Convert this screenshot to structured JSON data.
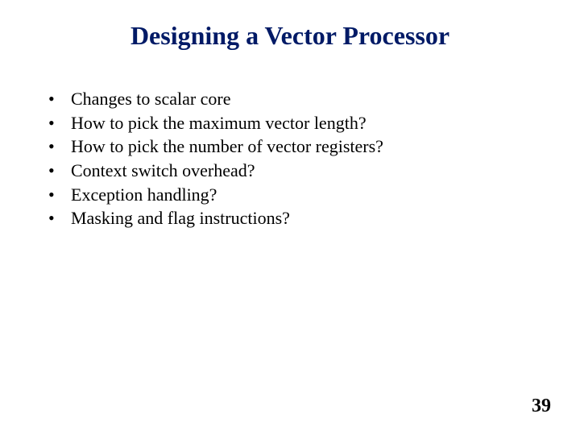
{
  "title": "Designing a Vector Processor",
  "bullets": [
    "Changes to scalar core",
    "How to pick the maximum vector length?",
    "How to pick the number of vector registers?",
    "Context switch overhead?",
    "Exception handling?",
    "Masking and flag instructions?"
  ],
  "page_number": "39"
}
